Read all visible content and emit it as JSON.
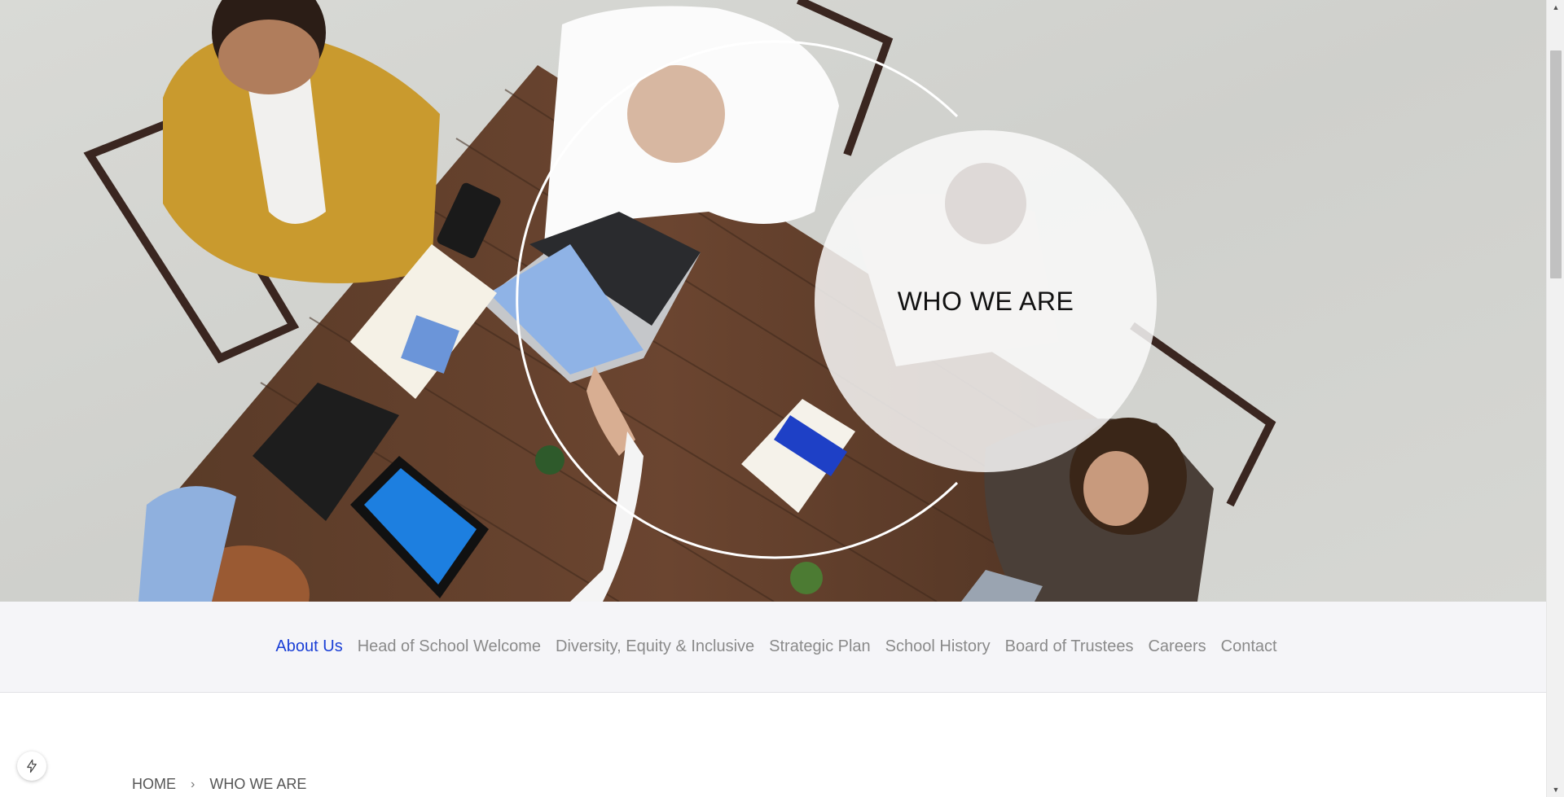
{
  "hero": {
    "title": "WHO WE ARE"
  },
  "subnav": {
    "items": [
      {
        "label": "About Us",
        "active": true
      },
      {
        "label": "Head of School Welcome",
        "active": false
      },
      {
        "label": "Diversity, Equity & Inclusive",
        "active": false
      },
      {
        "label": "Strategic Plan",
        "active": false
      },
      {
        "label": "School History",
        "active": false
      },
      {
        "label": "Board of Trustees",
        "active": false
      },
      {
        "label": "Careers",
        "active": false
      },
      {
        "label": "Contact",
        "active": false
      }
    ]
  },
  "breadcrumb": {
    "home": "HOME",
    "separator": "›",
    "current": "WHO WE ARE"
  },
  "fab": {
    "icon": "lightning-icon"
  },
  "scrollbar": {
    "up_icon": "arrow-up-icon",
    "down_icon": "arrow-down-icon"
  },
  "colors": {
    "accent": "#1a3fd6",
    "nav_text": "#8a8a8a",
    "nav_background": "#f5f5f8"
  }
}
